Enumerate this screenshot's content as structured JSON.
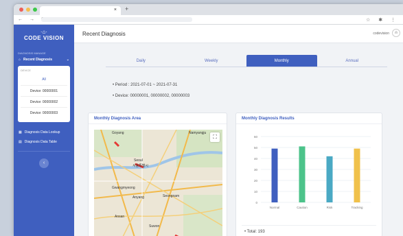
{
  "browser": {
    "tab_title": "",
    "new_tab": "+",
    "close": "×",
    "nav_icons": "← → C",
    "right_icons": "☆ ✱ ⋮",
    "dot_colors": [
      "#ee5f57",
      "#f6be4f",
      "#3dc84a"
    ]
  },
  "sidebar": {
    "logo_mark": "·⌂·",
    "logo_name": "CODE VISION",
    "section_label": "DIAGNOSIS MANAGE",
    "recent_label": "Recent Diagnosis",
    "device_label": "DEVICE",
    "devices": [
      "All",
      "Device: 00000001",
      "Device: 00000002",
      "Device: 00000003"
    ],
    "lookup_label": "Diagnosis Data Lookup",
    "table_label": "Diagnosis Data Table",
    "collapse_icon": "‹",
    "accent": "#3f5fbf"
  },
  "header": {
    "title": "Recent Diagnosis",
    "user": "codevision",
    "avatar_icon": "user-icon"
  },
  "tabs": [
    "Daily",
    "Weekly",
    "Monthly",
    "Annual"
  ],
  "active_tab": "Monthly",
  "info": {
    "period": "•  Period : 2021-07-01 ~ 2021-07-31",
    "device": "•  Device: 00000001, 00000002, 00000003"
  },
  "map_card": {
    "title": "Monthly Diagnosis Area",
    "fullscreen_icon": "⛶",
    "labels": [
      "Goyang",
      "Seoul",
      "서울특별시",
      "Gwangmyeong",
      "Anyang",
      "Seongnam",
      "Ansan",
      "Suwon",
      "Namyangju"
    ]
  },
  "results_card": {
    "title": "Monthly Diagnosis Results",
    "total": "•  Total: 193"
  },
  "chart_data": {
    "type": "bar",
    "categories": [
      "Normal",
      "Caution",
      "Risk",
      "Tracking"
    ],
    "values": [
      49,
      51,
      42,
      49
    ],
    "colors": [
      "#3f5fbf",
      "#4cc38a",
      "#4aa9c4",
      "#f0c14b"
    ],
    "ylim": [
      0,
      60
    ],
    "yticks": [
      0,
      10,
      20,
      30,
      40,
      50,
      60
    ],
    "grid": true
  }
}
